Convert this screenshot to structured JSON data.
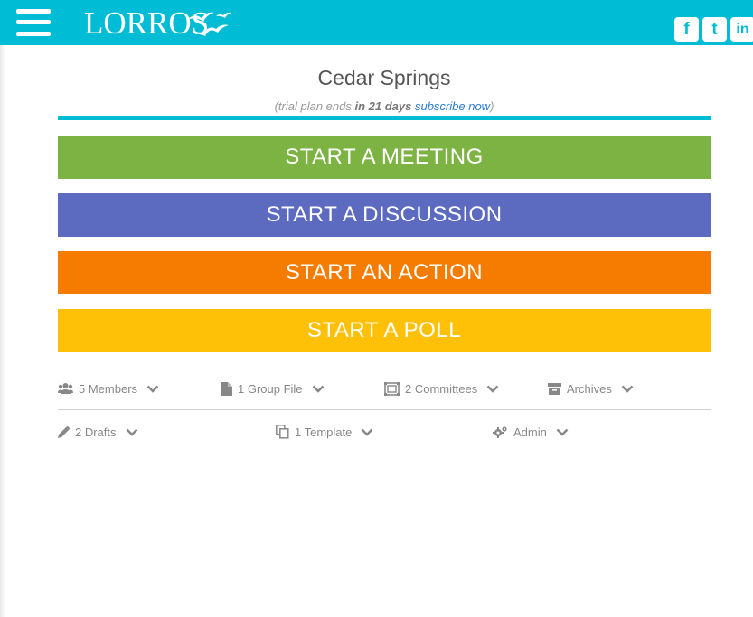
{
  "header": {
    "logo_text": "LORROS",
    "social": [
      {
        "icon": "facebook-icon",
        "glyph": "f"
      },
      {
        "icon": "twitter-icon",
        "glyph": "t"
      },
      {
        "icon": "linkedin-icon",
        "glyph": "in"
      }
    ],
    "colors": {
      "header_bg": "#00bcd4"
    }
  },
  "group": {
    "title": "Cedar Springs",
    "trial_prefix": "(trial plan ends ",
    "trial_days": "in 21 days",
    "trial_link": "subscribe now",
    "trial_suffix": ")"
  },
  "actions": [
    {
      "label": "START A MEETING",
      "color": "#7cb342"
    },
    {
      "label": "START A DISCUSSION",
      "color": "#5c6bc0"
    },
    {
      "label": "START AN ACTION",
      "color": "#f57c00"
    },
    {
      "label": "START A POLL",
      "color": "#ffc107"
    }
  ],
  "row1": [
    {
      "label": "5 Members",
      "icon": "members-icon"
    },
    {
      "label": "1 Group File",
      "icon": "file-icon"
    },
    {
      "label": "2 Committees",
      "icon": "committees-icon"
    },
    {
      "label": "Archives",
      "icon": "archive-icon"
    }
  ],
  "row2": [
    {
      "label": "2 Drafts",
      "icon": "pencil-icon"
    },
    {
      "label": "1 Template",
      "icon": "template-icon"
    },
    {
      "label": "Admin",
      "icon": "gears-icon"
    }
  ]
}
